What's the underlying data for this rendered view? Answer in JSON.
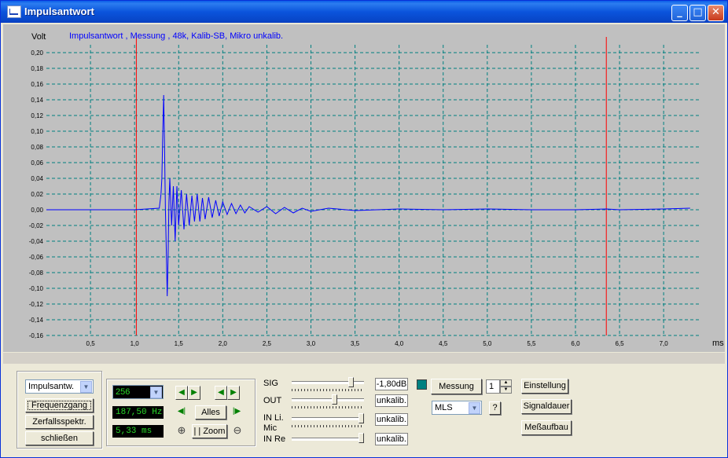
{
  "window": {
    "title": "Impulsantwort"
  },
  "plot": {
    "ylabel": "Volt",
    "xlabel": "ms",
    "title": "Impulsantwort , Messung , 48k, Kalib-SB, Mikro unkalib."
  },
  "chart_data": {
    "type": "line",
    "title": "Impulsantwort , Messung , 48k, Kalib-SB, Mikro unkalib.",
    "xlabel": "ms",
    "ylabel": "Volt",
    "xlim": [
      0,
      7.4
    ],
    "ylim": [
      -0.16,
      0.21
    ],
    "grid": true,
    "x_ticks": [
      "0,5",
      "1,0",
      "1,5",
      "2,0",
      "2,5",
      "3,0",
      "3,5",
      "4,0",
      "4,5",
      "5,0",
      "5,5",
      "6,0",
      "6,5",
      "7,0"
    ],
    "y_ticks": [
      "0,20",
      "0,18",
      "0,16",
      "0,14",
      "0,12",
      "0,10",
      "0,08",
      "0,06",
      "0,04",
      "0,02",
      "0,00",
      "-0,02",
      "-0,04",
      "-0,06",
      "-0,08",
      "-0,10",
      "-0,12",
      "-0,14",
      "-0,16"
    ],
    "markers": [
      1.02,
      6.35
    ],
    "series": [
      {
        "color": "#0000ff",
        "x": [
          0.0,
          0.5,
          1.0,
          1.28,
          1.3,
          1.31,
          1.32,
          1.33,
          1.34,
          1.35,
          1.36,
          1.37,
          1.38,
          1.39,
          1.4,
          1.42,
          1.44,
          1.46,
          1.48,
          1.5,
          1.53,
          1.56,
          1.59,
          1.62,
          1.65,
          1.68,
          1.71,
          1.74,
          1.77,
          1.8,
          1.84,
          1.88,
          1.92,
          1.96,
          2.0,
          2.05,
          2.1,
          2.15,
          2.2,
          2.25,
          2.3,
          2.4,
          2.5,
          2.6,
          2.7,
          2.8,
          2.9,
          3.0,
          3.2,
          3.5,
          4.0,
          4.5,
          5.0,
          5.5,
          6.0,
          6.35,
          6.5,
          7.0,
          7.3
        ],
        "values": [
          0.0,
          0.0,
          0.0,
          0.002,
          0.02,
          0.04,
          0.1,
          0.146,
          0.08,
          0.0,
          -0.05,
          -0.11,
          -0.06,
          0.01,
          0.04,
          -0.02,
          0.03,
          -0.04,
          0.03,
          -0.02,
          0.025,
          -0.025,
          0.02,
          -0.02,
          0.018,
          -0.015,
          0.02,
          -0.015,
          0.015,
          -0.012,
          0.016,
          -0.01,
          0.012,
          -0.008,
          0.01,
          -0.006,
          0.008,
          -0.005,
          0.006,
          -0.004,
          0.004,
          -0.003,
          0.004,
          -0.005,
          0.003,
          -0.004,
          0.002,
          -0.002,
          0.002,
          -0.001,
          0.001,
          0.0,
          0.001,
          0.0,
          0.0,
          0.001,
          0.0,
          0.001,
          0.002
        ]
      }
    ]
  },
  "controls": {
    "mode_select": "Impulsantw.",
    "btn_freq": "Frequenzgang",
    "btn_decay": "Zerfallsspektr.",
    "btn_close": "schließen",
    "points_select": "256",
    "freq_readout": "187,50 Hz",
    "time_readout": "5,33 ms",
    "btn_all": "Alles",
    "btn_zoom": "| | Zoom",
    "sig_label": "SIG",
    "out_label": "OUT",
    "in_li_label": "IN Li.",
    "mic_label": "Mic",
    "in_re_label": "IN Re",
    "sig_value": "-1,80dB",
    "out_value": "unkalib.",
    "in_li_value": "unkalib.",
    "in_re_value": "unkalib.",
    "sig_level": 0.85,
    "out_level": 0.6,
    "in_li_level": 1.0,
    "in_re_level": 1.0,
    "btn_measure": "Messung",
    "count_value": "1",
    "method_select": "MLS",
    "help_label": "?",
    "btn_settings": "Einstellung",
    "btn_signal": "Signaldauer",
    "btn_setup": "Meßaufbau"
  },
  "colors": {
    "trace": "#0000ff",
    "grid": "#008080",
    "marker": "#ff0000",
    "plot_bg": "#c0c0c0"
  }
}
